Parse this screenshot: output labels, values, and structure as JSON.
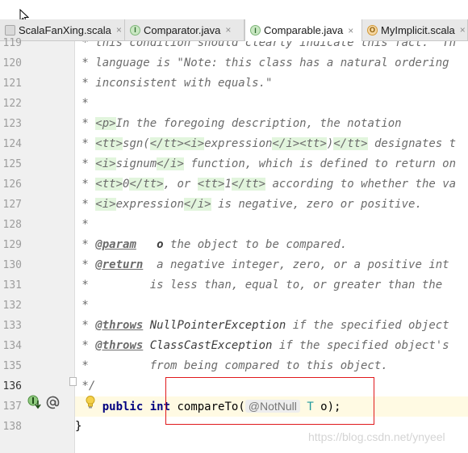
{
  "tabs": [
    {
      "label": "ScalaFanXing.scala",
      "icon": "scala-file-icon",
      "active": false
    },
    {
      "label": "Comparator.java",
      "icon": "interface-icon",
      "active": false
    },
    {
      "label": "Comparable.java",
      "icon": "interface-icon",
      "active": true
    },
    {
      "label": "MyImplicit.scala",
      "icon": "object-icon",
      "active": false
    }
  ],
  "icon_letters": {
    "interface": "I",
    "object": "O"
  },
  "close_glyph": "×",
  "line_numbers": [
    "119",
    "120",
    "121",
    "122",
    "123",
    "124",
    "125",
    "126",
    "127",
    "128",
    "129",
    "130",
    "131",
    "132",
    "133",
    "134",
    "135",
    "136",
    "137",
    "138"
  ],
  "code": {
    "l119": {
      "text": " * this condition should clearly indicate this fact.  Th"
    },
    "l120": {
      "text": " * language is \"Note: this class has a natural ordering"
    },
    "l121": {
      "text": " * inconsistent with equals.\""
    },
    "l122": {
      "text": " *"
    },
    "l123": {
      "a": " * ",
      "t1": "<p>",
      "b": "In the foregoing description, the notation"
    },
    "l124": {
      "a": " * ",
      "t1": "<tt>",
      "b": "sgn(",
      "t2": "</tt>",
      "t3": "<i>",
      "c": "expression",
      "t4": "</i>",
      "t5": "<tt>",
      "d": ")",
      "t6": "</tt>",
      "e": " designates t"
    },
    "l125": {
      "a": " * ",
      "t1": "<i>",
      "b": "signum",
      "t2": "</i>",
      "c": " function, which is defined to return on"
    },
    "l126": {
      "a": " * ",
      "t1": "<tt>",
      "b": "0",
      "t2": "</tt>",
      "c": ", or ",
      "t3": "<tt>",
      "d": "1",
      "t4": "</tt>",
      "e": " according to whether the va"
    },
    "l127": {
      "a": " * ",
      "t1": "<i>",
      "b": "expression",
      "t2": "</i>",
      "c": " is negative, zero or positive."
    },
    "l128": {
      "text": " *"
    },
    "l129": {
      "a": " * ",
      "tag": "@param",
      "b": "   ",
      "name": "o",
      "c": " the object to be compared."
    },
    "l130": {
      "a": " * ",
      "tag": "@return",
      "b": "  a negative integer, zero, or a positive int"
    },
    "l131": {
      "text": " *         is less than, equal to, or greater than the"
    },
    "l132": {
      "text": " *"
    },
    "l133": {
      "a": " * ",
      "tag": "@throws",
      "b": " ",
      "ref": "NullPointerException",
      "c": " if the specified object"
    },
    "l134": {
      "a": " * ",
      "tag": "@throws",
      "b": " ",
      "ref": "ClassCastException",
      "c": " if the specified object's"
    },
    "l135": {
      "text": " *         from being compared to this object."
    },
    "l136": {
      "text": " */"
    },
    "l137": {
      "indent": "    ",
      "kw1": "public",
      "sp1": " ",
      "kw2": "int",
      "sp2": " ",
      "name": "compareTo(",
      "hint": "@NotNull",
      "tparam": " T",
      "rest": " o);"
    },
    "l138": {
      "text": "}"
    }
  },
  "watermark": "https://blog.csdn.net/ynyeel"
}
